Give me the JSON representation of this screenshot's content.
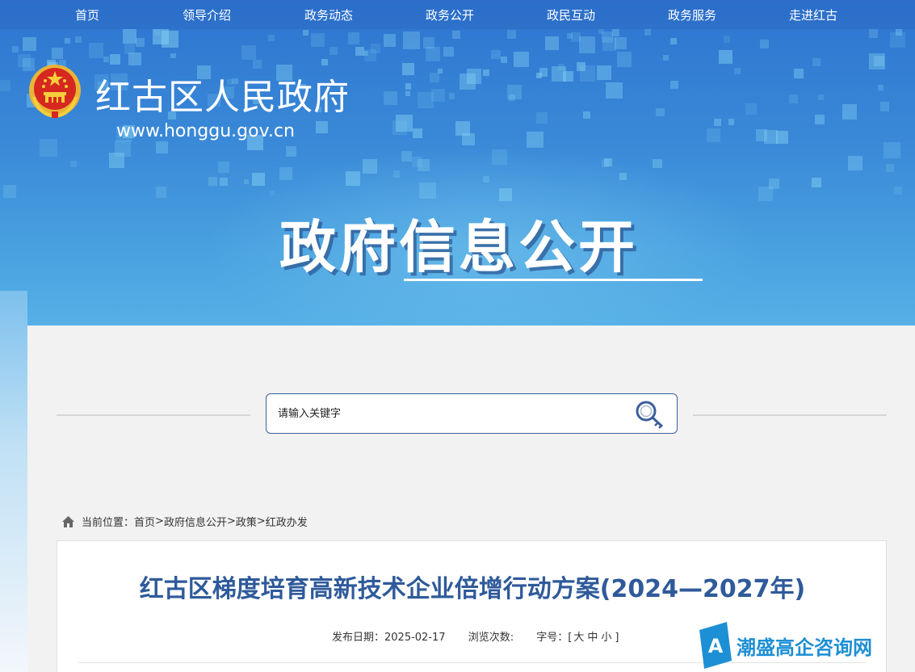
{
  "nav": {
    "items": [
      "首页",
      "领导介绍",
      "政务动态",
      "政务公开",
      "政民互动",
      "政务服务",
      "走进红古"
    ]
  },
  "header": {
    "site_title": "红古区人民政府",
    "site_url": "www.honggu.gov.cn",
    "banner_title": "政府信息公开"
  },
  "search": {
    "placeholder": "请输入关键字"
  },
  "breadcrumb": {
    "prefix": "当前位置：",
    "items": [
      "首页",
      "政府信息公开",
      "政策",
      "红政办发"
    ],
    "separator": ">"
  },
  "article": {
    "title": "红古区梯度培育高新技术企业倍增行动方案(2024—2027年)",
    "publish_label": "发布日期：",
    "publish_date": "2025-02-17",
    "views_label": "浏览次数:",
    "font_label": "字号：[",
    "font_large": "大",
    "font_medium": "中",
    "font_small": "小",
    "font_close": "]"
  },
  "watermark": {
    "text": "潮盛高企咨询网"
  },
  "colors": {
    "banner_blue": "#2e74d0",
    "title_blue": "#2f5a9a",
    "watermark_blue": "#1d8fd4",
    "search_border": "#3b5f9a"
  }
}
